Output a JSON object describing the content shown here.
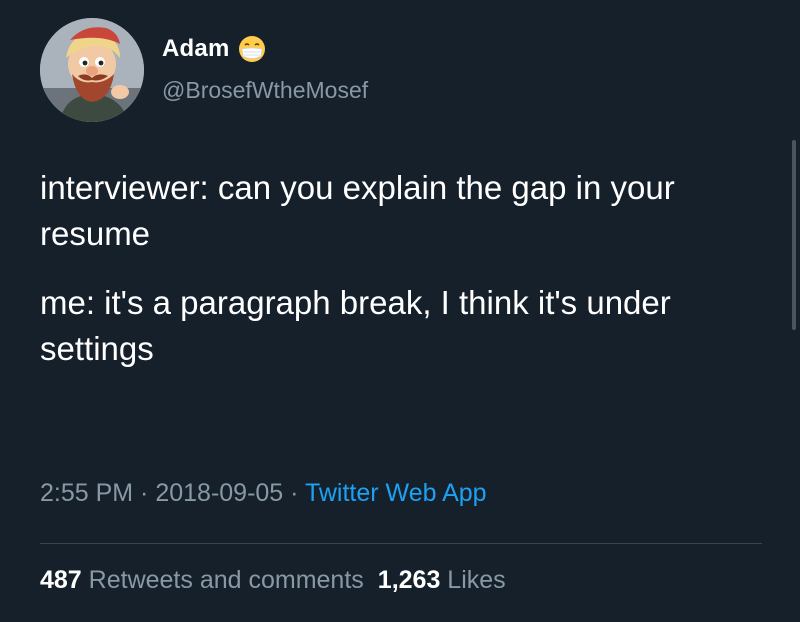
{
  "author": {
    "display_name": "Adam",
    "handle": "@BrosefWtheMosef",
    "avatar_icon": "cartoon-character-avatar",
    "name_emoji_icon": "face-with-medical-mask-emoji"
  },
  "tweet": {
    "paragraphs": [
      "interviewer: can you explain the gap in your resume",
      "me: it's a paragraph break, I think it's under settings"
    ]
  },
  "meta": {
    "time": "2:55 PM",
    "separator": " · ",
    "date": "2018-09-05",
    "source": "Twitter Web App"
  },
  "stats": {
    "retweets_count": "487",
    "retweets_label": " Retweets and comments",
    "likes_count": "1,263",
    "likes_label": " Likes"
  },
  "colors": {
    "background": "#15202b",
    "secondary_text": "#8899a6",
    "link": "#1da1f2",
    "divider": "#38444d"
  }
}
